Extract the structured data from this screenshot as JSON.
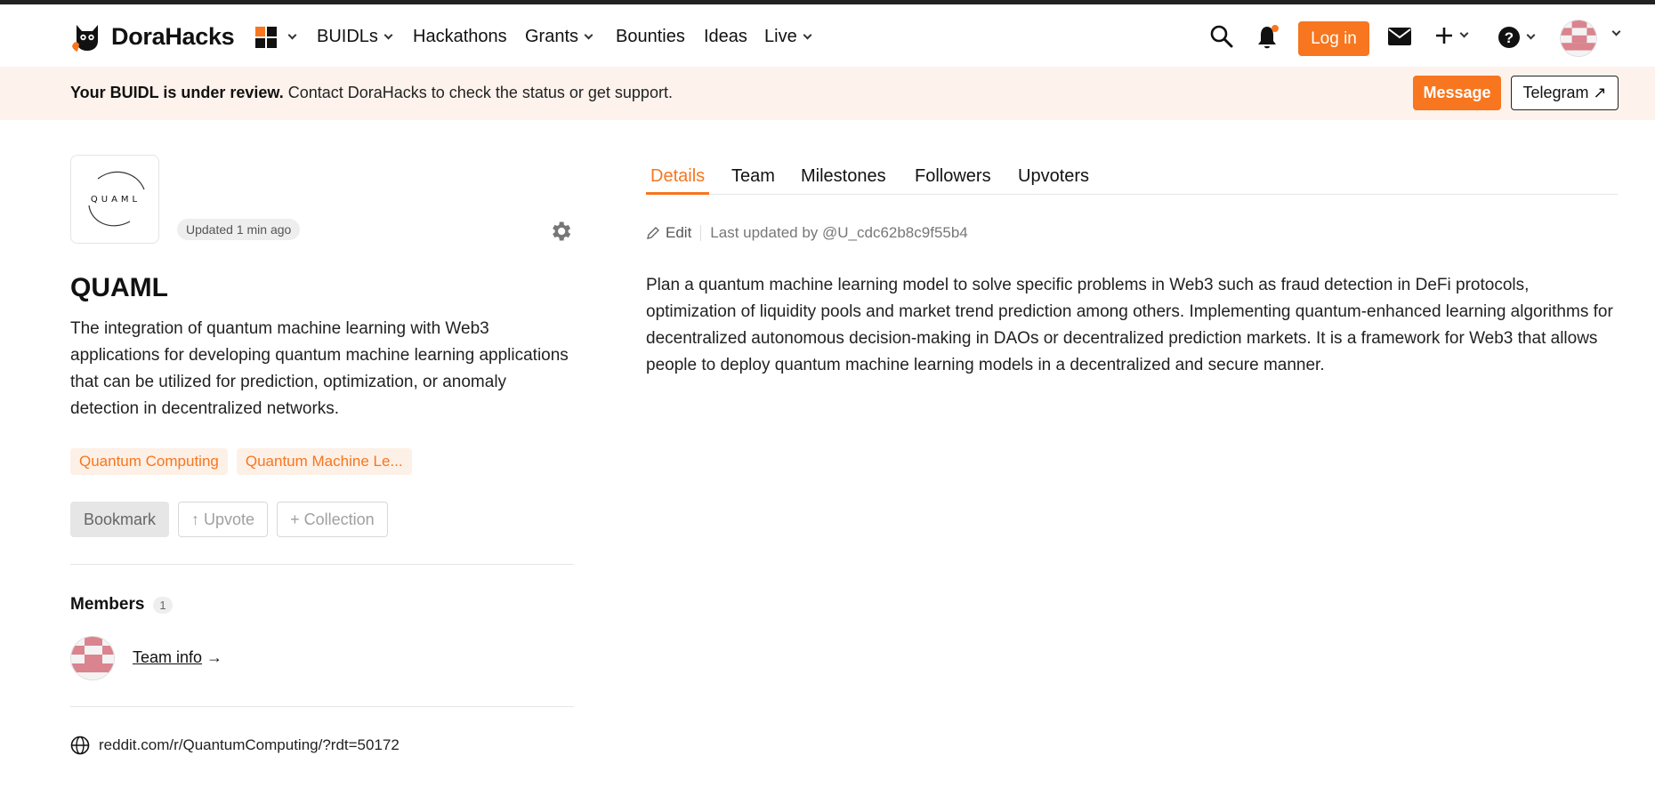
{
  "nav": {
    "brand": "DoraHacks",
    "menu": [
      {
        "label": "BUIDLs",
        "has_dropdown": true
      },
      {
        "label": "Hackathons",
        "has_dropdown": false
      },
      {
        "label": "Grants",
        "has_dropdown": true
      },
      {
        "label": "Bounties",
        "has_dropdown": false
      },
      {
        "label": "Ideas",
        "has_dropdown": false
      },
      {
        "label": "Live",
        "has_dropdown": true
      }
    ],
    "login_label": "Log in",
    "icons": [
      "apps-grid-icon",
      "search-icon",
      "bell-icon",
      "mail-icon",
      "plus-icon",
      "help-icon",
      "user-avatar"
    ]
  },
  "banner": {
    "bold_text": "Your BUIDL is under review.",
    "text": " Contact DoraHacks to check the status or get support.",
    "message_label": "Message",
    "telegram_label": "Telegram ↗"
  },
  "project": {
    "logo_text": "QUAML",
    "updated": "Updated 1 min ago",
    "title": "QUAML",
    "description": "The integration of quantum machine learning with Web3 applications for developing quantum machine learning applications that can be utilized for prediction, optimization, or anomaly detection in decentralized networks.",
    "tags": [
      "Quantum Computing",
      "Quantum Machine Le..."
    ],
    "actions": {
      "bookmark": "Bookmark",
      "upvote": "↑ Upvote",
      "collection": "+ Collection"
    },
    "members_title": "Members",
    "members_count": "1",
    "team_info_label": "Team info",
    "team_info_arrow": " →",
    "link": "reddit.com/r/QuantumComputing/?rdt=50172"
  },
  "tabs": [
    {
      "label": "Details",
      "active": true
    },
    {
      "label": "Team",
      "active": false
    },
    {
      "label": "Milestones",
      "active": false
    },
    {
      "label": "Followers",
      "active": false
    },
    {
      "label": "Upvoters",
      "active": false
    }
  ],
  "details": {
    "edit_label": "Edit",
    "last_updated": "Last updated by @U_cdc62b8c9f55b4",
    "body": "Plan a quantum machine learning model to solve specific problems in Web3 such as fraud detection in DeFi protocols, optimization of liquidity pools and market trend prediction among others. Implementing quantum-enhanced learning algorithms for decentralized autonomous decision-making in DAOs or decentralized prediction markets. It is a framework for Web3 that allows people to deploy quantum machine learning models in a decentralized and secure manner."
  },
  "colors": {
    "accent": "#f7761f",
    "banner_bg": "#fdf3ec",
    "tag_bg": "#fdf0e6",
    "avatar_pink": "#d9848f"
  }
}
